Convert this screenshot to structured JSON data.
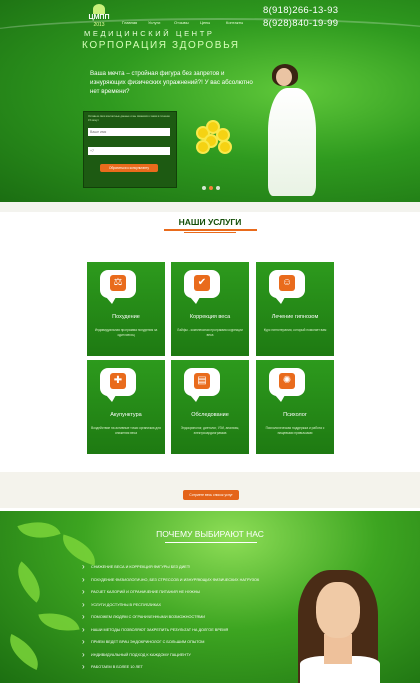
{
  "header": {
    "logo_abbr": "ЦМПП",
    "logo_year": "2013",
    "nav": [
      "Главная",
      "Услуги",
      "Отзывы",
      "Цены",
      "Контакты"
    ],
    "phones": [
      "8(918)266-13-93",
      "8(928)840-19-99"
    ],
    "title_line1": "МЕДИЦИНСКИЙ ЦЕНТР",
    "title_line2": "КОРПОРАЦИЯ ЗДОРОВЬЯ"
  },
  "hero": {
    "headline": "Ваша мечта – стройная фигура без запретов и изнуряющих физических упражнений?! У вас абсолютно нет времени?",
    "form": {
      "note": "Оставьте свои контактные данные и мы свяжемся с вами в течение 15 минут",
      "name_placeholder": "Ваше имя",
      "phone_placeholder": "+7",
      "button_label": "Обратиться к консультанту"
    },
    "slider_dots": 3,
    "active_dot": 1
  },
  "services": {
    "title": "НАШИ УСЛУГИ",
    "items": [
      {
        "name": "Похудение",
        "desc": "Индивидуальная программа похудения за один месяц",
        "icon": "scale-icon",
        "glyph": "⚖"
      },
      {
        "name": "Коррекция веса",
        "desc": "Лайфы - комплексная программа коррекции веса",
        "icon": "checklist-icon",
        "glyph": "✔"
      },
      {
        "name": "Лечение гипнозом",
        "desc": "Курс гипнотерапии, который помогает вам",
        "icon": "head-icon",
        "glyph": "☺"
      },
      {
        "name": "Акупунктура",
        "desc": "Воздействие на активные точки организма для снижения веса",
        "icon": "acupuncture-icon",
        "glyph": "✚"
      },
      {
        "name": "Обследование",
        "desc": "Эндокринолог, диетолог, УЗИ, анализы, электрокардиограмма",
        "icon": "laptop-icon",
        "glyph": "▤"
      },
      {
        "name": "Психолог",
        "desc": "Психологическая поддержка и работа с пищевыми привычками",
        "icon": "laser-icon",
        "glyph": "✺"
      }
    ],
    "all_button": "Сотриете весь список услуг"
  },
  "why": {
    "title": "ПОЧЕМУ ВЫБИРАЮТ НАС",
    "items": [
      "СНИЖЕНИЕ ВЕСА И КОРРЕКЦИЯ ФИГУРЫ БЕЗ ДИЕТ!",
      "ПОХУДЕНИЕ ФИЗИОЛОГИЧНО, БЕЗ СТРЕССОВ И ИЗНУРЯЮЩИХ ФИЗИЧЕСКИХ НАГРУЗОК",
      "РАСЧЕТ КАЛОРИЙ И ОГРАНИЧЕНИЕ ПИТАНИЯ НЕ НУЖНЫ",
      "УСЛУГИ ДОСТУПНЫ В РЕСПУБЛИКАХ",
      "ПОМОЖЕМ ЛЮДЯМ С ОГРАНИЧЕННЫМИ ВОЗМОЖНОСТЯМИ",
      "НАШИ МЕТОДЫ ПОЗВОЛЯЮТ ЗАКРЕПИТЬ РЕЗУЛЬТАТ НА ДОЛГОЕ ВРЕМЯ",
      "ПРИЕМ ВЕДЕТ ВРАЧ ЭНДОКРИНОЛОГ С БОЛЬШИМ ОПЫТОМ",
      "ИНДИВИДУАЛЬНЫЙ ПОДХОД К КАЖДОМУ ПАЦИЕНТУ",
      "РАБОТАЕМ В БОЛЕЕ 10 ЛЕТ"
    ]
  },
  "colors": {
    "brand_green": "#2f9a1f",
    "dark_green": "#134e08",
    "accent_orange": "#e96b1c"
  }
}
